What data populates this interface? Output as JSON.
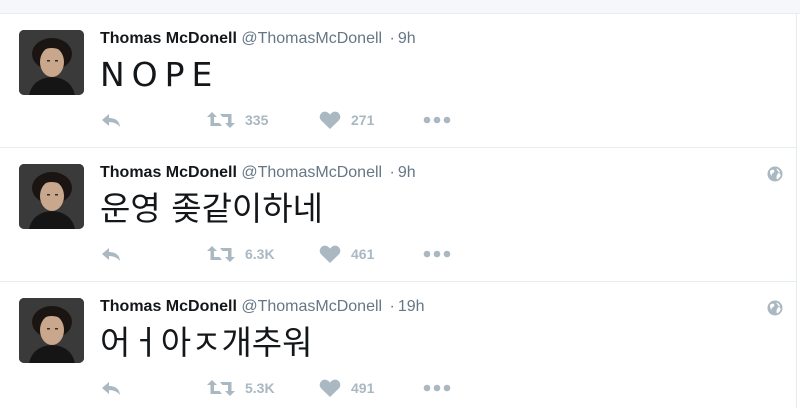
{
  "tweets": [
    {
      "name": "Thomas McDonell",
      "handle": "@ThomasMcDonell",
      "separator": "·",
      "time": "9h",
      "text": "NOPE",
      "retweets": "335",
      "likes": "271",
      "globe": false
    },
    {
      "name": "Thomas McDonell",
      "handle": "@ThomasMcDonell",
      "separator": "·",
      "time": "9h",
      "text": "운영 좆같이하네",
      "retweets": "6.3K",
      "likes": "461",
      "globe": true
    },
    {
      "name": "Thomas McDonell",
      "handle": "@ThomasMcDonell",
      "separator": "·",
      "time": "19h",
      "text": "어ㅓ아ㅈ개추워",
      "retweets": "5.3K",
      "likes": "491",
      "globe": true
    }
  ],
  "icons": {
    "reply": "reply-icon",
    "retweet": "retweet-icon",
    "like": "heart-icon",
    "more": "more-icon",
    "globe": "globe-icon"
  },
  "colors": {
    "icon": "#aab8c2",
    "name": "#14171a",
    "meta": "#657786",
    "border": "#e6ecf0"
  }
}
